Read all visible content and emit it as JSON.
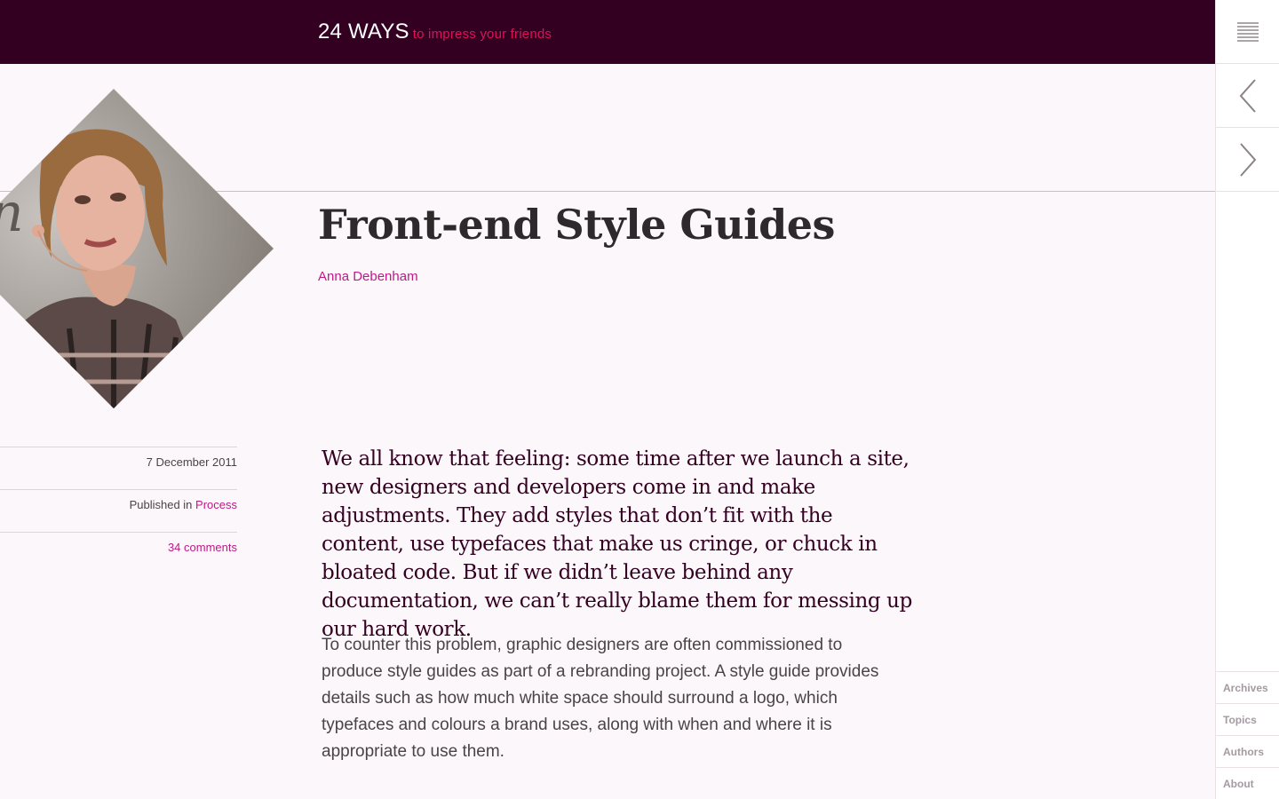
{
  "header": {
    "brand": "24 WAYS",
    "tagline": "to impress your friends"
  },
  "nav": {
    "menu_icon": "hamburger-icon",
    "prev_icon": "chevron-left-icon",
    "next_icon": "chevron-right-icon",
    "links": [
      "Archives",
      "Topics",
      "Authors",
      "About"
    ]
  },
  "article": {
    "title": "Front-end Style Guides",
    "author": "Anna Debenham",
    "date": "7 December 2011",
    "published_prefix": "Published in",
    "category": "Process",
    "comments": "34 comments",
    "lede": "We all know that feeling: some time after we launch a site, new designers and developers come in and make adjustments. They add styles that don’t fit with the content, use typefaces that make us cringe, or chuck in bloated code. But if we didn’t leave behind any documentation, we can’t really blame them for messing up our hard work.",
    "paragraph": "To counter this problem, graphic designers are often commissioned to produce style guides as part of a rebranding project. A style guide provides details such as how much white space should surround a logo, which typefaces and colours a brand uses, along with when and where it is appropriate to use them."
  },
  "colors": {
    "header_bg": "#330022",
    "accent": "#c0178a",
    "tagline": "#e0105a"
  }
}
